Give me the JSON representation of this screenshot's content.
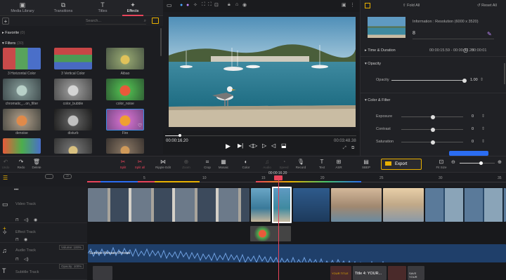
{
  "tabs": [
    {
      "label": "Media Library",
      "icon": "media-library-icon"
    },
    {
      "label": "Transitions",
      "icon": "transitions-icon"
    },
    {
      "label": "Titles",
      "icon": "titles-icon"
    },
    {
      "label": "Effects",
      "icon": "effects-icon",
      "active": true
    }
  ],
  "search": {
    "placeholder": "Search..."
  },
  "library": {
    "favorite_label": "Favorite",
    "favorite_count": "(0)",
    "filters_label": "Filters",
    "filters_count": "(30)",
    "items": [
      "3 Horizontal Color",
      "3 Vertical Color",
      "Aibao",
      "chromatic_...on_filter",
      "color_bubble",
      "color_noise",
      "denoise",
      "disturb",
      "Fire"
    ]
  },
  "preview": {
    "current_time": "00:00:16.20",
    "total_time": "00:03:48.38"
  },
  "right_panel": {
    "fold_all": "Fold All",
    "reset_all": "Reset All",
    "info": "Information : Resolution (6000 x 3520)",
    "duration_value": "8",
    "time_section": "Time & Duration",
    "time_range": "00:00:15.59 - 00:00:17.28",
    "time_duration": "00:00:01",
    "opacity_section": "Opacity",
    "opacity_label": "Opacity",
    "opacity_value": "1.00",
    "color_section": "Color & Filter",
    "exposure_label": "Exposure",
    "exposure_value": "0",
    "contrast_label": "Contrast",
    "contrast_value": "0",
    "saturation_label": "Saturation",
    "saturation_value": "0",
    "opacity_level": 1.0
  },
  "toolbar": {
    "items": [
      {
        "label": "Undo",
        "icon": "undo-icon",
        "state": "dim"
      },
      {
        "label": "Redo",
        "icon": "redo-icon"
      },
      {
        "label": "Delete",
        "icon": "delete-icon"
      },
      {
        "label": "Split",
        "icon": "split-icon",
        "state": "red"
      },
      {
        "label": "Split all",
        "icon": "split-all-icon",
        "state": "red"
      },
      {
        "label": "Ripple Edit",
        "icon": "ripple-edit-icon"
      },
      {
        "label": "Zoom",
        "icon": "zoom-icon",
        "state": "dim"
      },
      {
        "label": "Crop",
        "icon": "crop-icon"
      },
      {
        "label": "Mosaic",
        "icon": "mosaic-icon"
      },
      {
        "label": "Color",
        "icon": "color-icon"
      },
      {
        "label": "Audio",
        "icon": "audio-icon",
        "state": "dim"
      },
      {
        "label": "Speed",
        "icon": "speed-icon",
        "state": "dim"
      },
      {
        "label": "Record",
        "icon": "record-icon"
      },
      {
        "label": "Text",
        "icon": "text-icon"
      },
      {
        "label": "ASR",
        "icon": "asr-icon"
      },
      {
        "label": "SBEP",
        "icon": "sbep-icon"
      }
    ],
    "export_label": "Export",
    "fit_size": "Fit Size"
  },
  "timeline": {
    "playhead_time": "00:00:16.20",
    "ruler_marks": [
      "5",
      "10",
      "15",
      "20",
      "25",
      "30",
      "35"
    ],
    "tracks": [
      {
        "name": "Video Track",
        "icon": "video-track-icon"
      },
      {
        "name": "Effect Track",
        "icon": "effect-track-icon"
      },
      {
        "name": "Audio Track",
        "icon": "audio-track-icon",
        "volume": "Volume: 100%"
      },
      {
        "name": "Subtitle Track",
        "icon": "subtitle-track-icon",
        "opacity": "Opacity: 100%"
      }
    ],
    "audio_clip_label": "Sunrise-Henaeu Presse",
    "subtitle_clips": [
      "YOUR TITLE",
      "Title 4: YOUR...",
      "SAVE YOUR"
    ]
  },
  "colors": {
    "accent": "#e8445a",
    "highlight": "#e8b000",
    "slider": "#2b6df2"
  }
}
